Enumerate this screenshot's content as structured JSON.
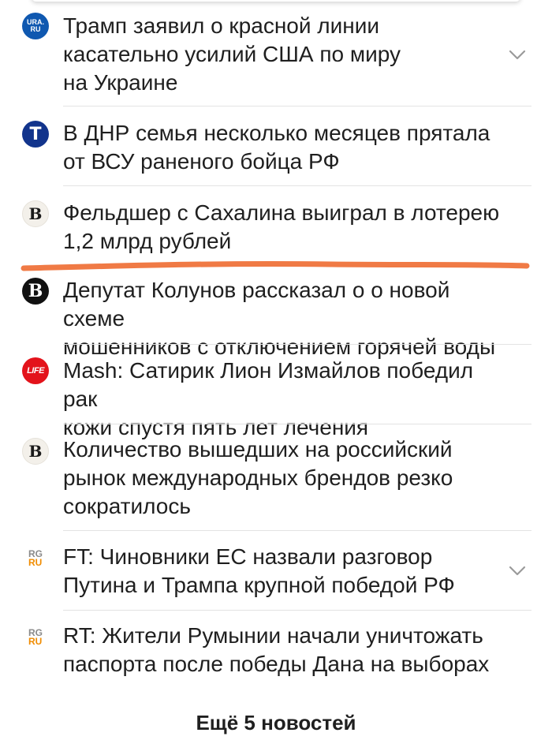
{
  "feed": {
    "items": [
      {
        "source": "URA.RU",
        "icon": "ura-ru-icon",
        "icon_text_1": "URA.",
        "icon_text_2": "RU",
        "title_lines": [
          "Трамп заявил о красной линии",
          "касательно усилий США по миру",
          "на Украине"
        ],
        "has_chevron": true
      },
      {
        "source": "T",
        "icon": "t-icon",
        "icon_text_1": "T",
        "title_lines": [
          "В ДНР семья несколько месяцев прятала",
          "от ВСУ раненого бойца РФ"
        ],
        "has_chevron": false
      },
      {
        "source": "B",
        "icon": "b-icon",
        "icon_text_1": "B",
        "title_lines": [
          "Фельдшер с Сахалина выиграл в лотерею",
          "1,2 млрд рублей"
        ],
        "has_chevron": false
      },
      {
        "source": "B",
        "icon": "b-dark-icon",
        "icon_text_1": "B",
        "title_lines": [
          "Депутат Колунов рассказал о о новой схеме",
          "мошенников с отключением горячей воды"
        ],
        "has_chevron": false
      },
      {
        "source": "LIFE",
        "icon": "life-icon",
        "icon_text_1": "LIFE",
        "title_lines": [
          "Mash: Сатирик Лион Измайлов победил рак",
          "кожи спустя пять лет лечения"
        ],
        "has_chevron": false
      },
      {
        "source": "B",
        "icon": "b-icon",
        "icon_text_1": "B",
        "title_lines": [
          "Количество вышедших на российский",
          "рынок международных брендов резко",
          "сократилось"
        ],
        "has_chevron": false
      },
      {
        "source": "RG RU",
        "icon": "rg-ru-icon",
        "icon_text_1": "RG",
        "icon_text_2": "RU",
        "title_lines": [
          "FT: Чиновники ЕС назвали разговор",
          "Путина и Трампа крупной победой РФ"
        ],
        "has_chevron": true
      },
      {
        "source": "RG RU",
        "icon": "rg-ru-icon",
        "icon_text_1": "RG",
        "icon_text_2": "RU",
        "title_lines": [
          "RT: Жители Румынии начали уничтожать",
          "паспорта после победы Дана на выборах"
        ],
        "has_chevron": false
      }
    ],
    "more_label": "Ещё 5 новостей"
  },
  "colors": {
    "annotation_line": "#f07a45",
    "separator": "#e3e3e3",
    "text": "#1f1f1f",
    "chevron": "#9a9a9a"
  }
}
